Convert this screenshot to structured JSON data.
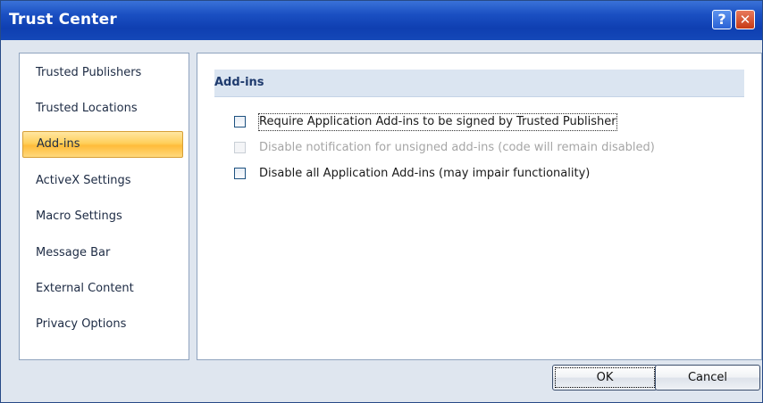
{
  "window": {
    "title": "Trust Center",
    "help_glyph": "?",
    "close_glyph": "✕"
  },
  "sidebar": {
    "items": [
      {
        "label": "Trusted Publishers",
        "selected": false
      },
      {
        "label": "Trusted Locations",
        "selected": false
      },
      {
        "label": "Add-ins",
        "selected": true
      },
      {
        "label": "ActiveX Settings",
        "selected": false
      },
      {
        "label": "Macro Settings",
        "selected": false
      },
      {
        "label": "Message Bar",
        "selected": false
      },
      {
        "label": "External Content",
        "selected": false
      },
      {
        "label": "Privacy Options",
        "selected": false
      }
    ]
  },
  "main": {
    "section_title": "Add-ins",
    "options": [
      {
        "label": "Require Application Add-ins to be signed by Trusted Publisher",
        "checked": false,
        "enabled": true
      },
      {
        "label": "Disable notification for unsigned add-ins (code will remain disabled)",
        "checked": false,
        "enabled": false
      },
      {
        "label": "Disable all Application Add-ins (may impair functionality)",
        "checked": false,
        "enabled": true
      }
    ]
  },
  "buttons": {
    "ok": "OK",
    "cancel": "Cancel"
  },
  "colors": {
    "titlebar": "#1a4fc2",
    "selection": "#ffcf5b",
    "section_header_bg": "#dbe5f1"
  }
}
